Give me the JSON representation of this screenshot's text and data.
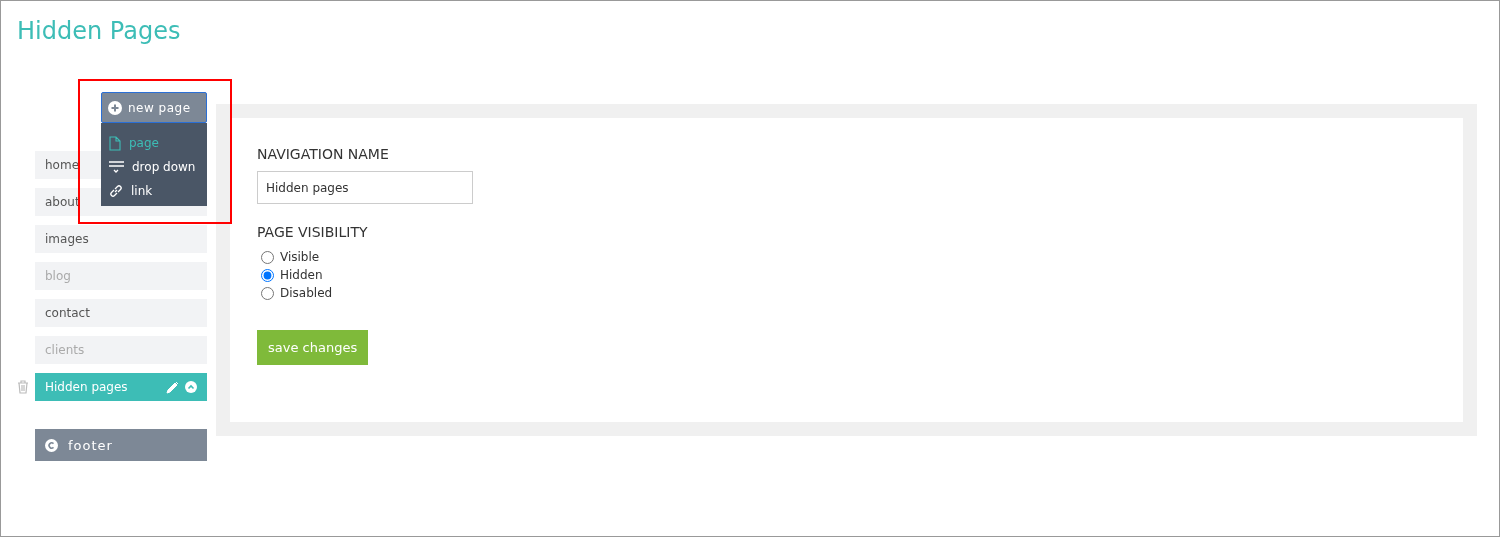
{
  "title": "Hidden Pages",
  "new_page_button": {
    "label": "new page"
  },
  "new_page_menu": [
    {
      "kind": "page",
      "label": "page",
      "selected": true
    },
    {
      "kind": "dropdown",
      "label": "drop down",
      "selected": false
    },
    {
      "kind": "link",
      "label": "link",
      "selected": false
    }
  ],
  "pages": [
    {
      "label": "home",
      "hidden": false,
      "selected": false
    },
    {
      "label": "about",
      "hidden": false,
      "selected": false
    },
    {
      "label": "images",
      "hidden": false,
      "selected": false
    },
    {
      "label": "blog",
      "hidden": true,
      "selected": false
    },
    {
      "label": "contact",
      "hidden": false,
      "selected": false
    },
    {
      "label": "clients",
      "hidden": true,
      "selected": false
    },
    {
      "label": "Hidden pages",
      "hidden": false,
      "selected": true
    }
  ],
  "footer": {
    "label": "footer"
  },
  "form": {
    "name_label": "NAVIGATION NAME",
    "name_value": "Hidden pages",
    "visibility_label": "PAGE VISIBILITY",
    "options": [
      {
        "label": "Visible",
        "selected": false
      },
      {
        "label": "Hidden",
        "selected": true
      },
      {
        "label": "Disabled",
        "selected": false
      }
    ],
    "save_button": "save changes"
  }
}
